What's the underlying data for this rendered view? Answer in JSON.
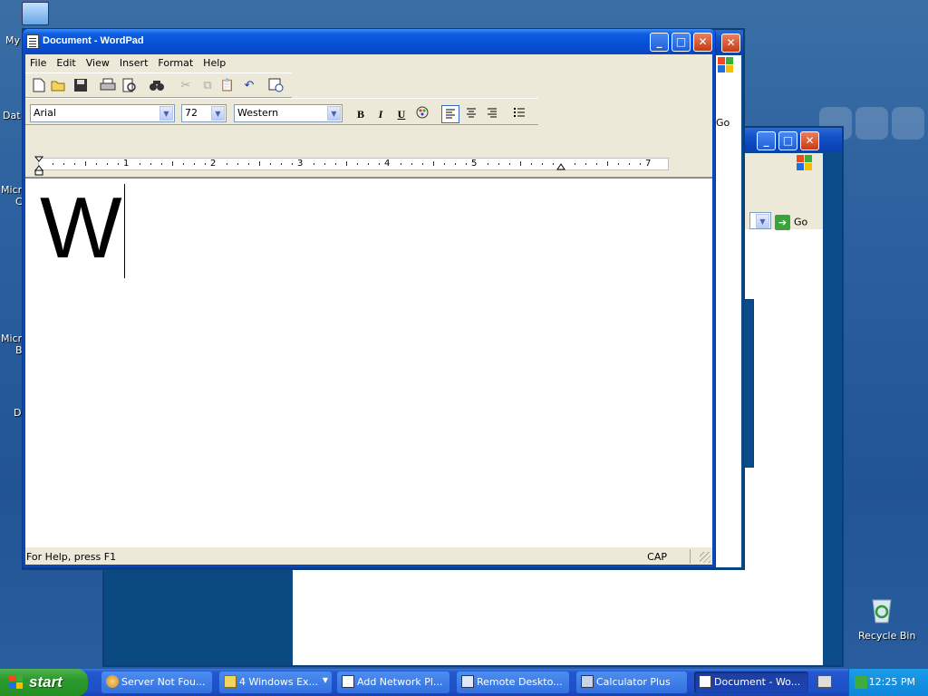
{
  "desktop": {
    "icon_labels": [
      {
        "name": "my-computer-label",
        "text": "My"
      },
      {
        "name": "data-label",
        "text": "Dat"
      },
      {
        "name": "microsoft-label",
        "text": "Micro"
      },
      {
        "name": "microsoft-c-label",
        "text": "C"
      },
      {
        "name": "microsoft-2-label",
        "text": "Micro"
      },
      {
        "name": "b-label",
        "text": "B"
      },
      {
        "name": "d-label",
        "text": "D"
      }
    ],
    "recycle_bin": "Recycle Bin"
  },
  "background_windows": {
    "go_label_1": "Go",
    "go_label_2": "Go"
  },
  "wordpad": {
    "title": "Document - WordPad",
    "menu": [
      "File",
      "Edit",
      "View",
      "Insert",
      "Format",
      "Help"
    ],
    "toolbar_icons": [
      "new-icon",
      "open-icon",
      "save-icon",
      "print-icon",
      "print-preview-icon",
      "find-icon",
      "cut-icon",
      "copy-icon",
      "paste-icon",
      "undo-icon",
      "date-time-icon"
    ],
    "font_name": "Arial",
    "font_size": "72",
    "script": "Western",
    "format_buttons": {
      "bold": "B",
      "italic": "I",
      "underline": "U"
    },
    "ruler_numbers": [
      "1",
      "2",
      "3",
      "4",
      "5",
      "7"
    ],
    "document_text": "W",
    "status_help": "For Help, press F1",
    "status_cap": "CAP"
  },
  "taskbar": {
    "start_label": "start",
    "tasks": [
      {
        "label": "Server Not Fou...",
        "active": false
      },
      {
        "label": "4 Windows Ex...",
        "active": false
      },
      {
        "label": "Add Network Pl...",
        "active": false
      },
      {
        "label": "Remote Deskto...",
        "active": false
      },
      {
        "label": "Calculator Plus",
        "active": false
      },
      {
        "label": "Document - Wo...",
        "active": true
      }
    ],
    "clock": "12:25 PM"
  },
  "colors": {
    "desktop": "#2b5f9e",
    "titlebar": "#0650d6",
    "taskbar": "#1d4fc6",
    "start": "#2b9a2b"
  }
}
